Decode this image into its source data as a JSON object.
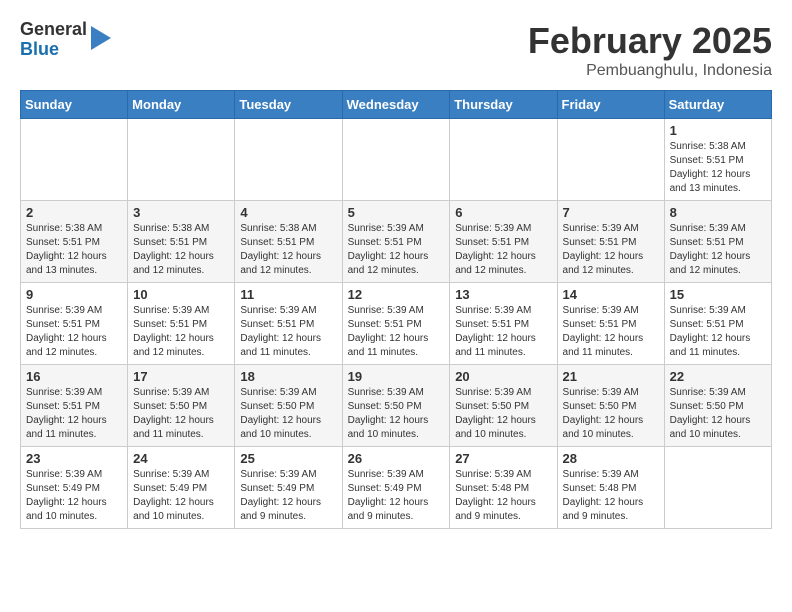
{
  "header": {
    "logo": {
      "general": "General",
      "blue": "Blue"
    },
    "title": "February 2025",
    "location": "Pembuanghulu, Indonesia"
  },
  "calendar": {
    "weekdays": [
      "Sunday",
      "Monday",
      "Tuesday",
      "Wednesday",
      "Thursday",
      "Friday",
      "Saturday"
    ],
    "weeks": [
      [
        {
          "day": "",
          "info": ""
        },
        {
          "day": "",
          "info": ""
        },
        {
          "day": "",
          "info": ""
        },
        {
          "day": "",
          "info": ""
        },
        {
          "day": "",
          "info": ""
        },
        {
          "day": "",
          "info": ""
        },
        {
          "day": "1",
          "info": "Sunrise: 5:38 AM\nSunset: 5:51 PM\nDaylight: 12 hours\nand 13 minutes."
        }
      ],
      [
        {
          "day": "2",
          "info": "Sunrise: 5:38 AM\nSunset: 5:51 PM\nDaylight: 12 hours\nand 13 minutes."
        },
        {
          "day": "3",
          "info": "Sunrise: 5:38 AM\nSunset: 5:51 PM\nDaylight: 12 hours\nand 12 minutes."
        },
        {
          "day": "4",
          "info": "Sunrise: 5:38 AM\nSunset: 5:51 PM\nDaylight: 12 hours\nand 12 minutes."
        },
        {
          "day": "5",
          "info": "Sunrise: 5:39 AM\nSunset: 5:51 PM\nDaylight: 12 hours\nand 12 minutes."
        },
        {
          "day": "6",
          "info": "Sunrise: 5:39 AM\nSunset: 5:51 PM\nDaylight: 12 hours\nand 12 minutes."
        },
        {
          "day": "7",
          "info": "Sunrise: 5:39 AM\nSunset: 5:51 PM\nDaylight: 12 hours\nand 12 minutes."
        },
        {
          "day": "8",
          "info": "Sunrise: 5:39 AM\nSunset: 5:51 PM\nDaylight: 12 hours\nand 12 minutes."
        }
      ],
      [
        {
          "day": "9",
          "info": "Sunrise: 5:39 AM\nSunset: 5:51 PM\nDaylight: 12 hours\nand 12 minutes."
        },
        {
          "day": "10",
          "info": "Sunrise: 5:39 AM\nSunset: 5:51 PM\nDaylight: 12 hours\nand 12 minutes."
        },
        {
          "day": "11",
          "info": "Sunrise: 5:39 AM\nSunset: 5:51 PM\nDaylight: 12 hours\nand 11 minutes."
        },
        {
          "day": "12",
          "info": "Sunrise: 5:39 AM\nSunset: 5:51 PM\nDaylight: 12 hours\nand 11 minutes."
        },
        {
          "day": "13",
          "info": "Sunrise: 5:39 AM\nSunset: 5:51 PM\nDaylight: 12 hours\nand 11 minutes."
        },
        {
          "day": "14",
          "info": "Sunrise: 5:39 AM\nSunset: 5:51 PM\nDaylight: 12 hours\nand 11 minutes."
        },
        {
          "day": "15",
          "info": "Sunrise: 5:39 AM\nSunset: 5:51 PM\nDaylight: 12 hours\nand 11 minutes."
        }
      ],
      [
        {
          "day": "16",
          "info": "Sunrise: 5:39 AM\nSunset: 5:51 PM\nDaylight: 12 hours\nand 11 minutes."
        },
        {
          "day": "17",
          "info": "Sunrise: 5:39 AM\nSunset: 5:50 PM\nDaylight: 12 hours\nand 11 minutes."
        },
        {
          "day": "18",
          "info": "Sunrise: 5:39 AM\nSunset: 5:50 PM\nDaylight: 12 hours\nand 10 minutes."
        },
        {
          "day": "19",
          "info": "Sunrise: 5:39 AM\nSunset: 5:50 PM\nDaylight: 12 hours\nand 10 minutes."
        },
        {
          "day": "20",
          "info": "Sunrise: 5:39 AM\nSunset: 5:50 PM\nDaylight: 12 hours\nand 10 minutes."
        },
        {
          "day": "21",
          "info": "Sunrise: 5:39 AM\nSunset: 5:50 PM\nDaylight: 12 hours\nand 10 minutes."
        },
        {
          "day": "22",
          "info": "Sunrise: 5:39 AM\nSunset: 5:50 PM\nDaylight: 12 hours\nand 10 minutes."
        }
      ],
      [
        {
          "day": "23",
          "info": "Sunrise: 5:39 AM\nSunset: 5:49 PM\nDaylight: 12 hours\nand 10 minutes."
        },
        {
          "day": "24",
          "info": "Sunrise: 5:39 AM\nSunset: 5:49 PM\nDaylight: 12 hours\nand 10 minutes."
        },
        {
          "day": "25",
          "info": "Sunrise: 5:39 AM\nSunset: 5:49 PM\nDaylight: 12 hours\nand 9 minutes."
        },
        {
          "day": "26",
          "info": "Sunrise: 5:39 AM\nSunset: 5:49 PM\nDaylight: 12 hours\nand 9 minutes."
        },
        {
          "day": "27",
          "info": "Sunrise: 5:39 AM\nSunset: 5:48 PM\nDaylight: 12 hours\nand 9 minutes."
        },
        {
          "day": "28",
          "info": "Sunrise: 5:39 AM\nSunset: 5:48 PM\nDaylight: 12 hours\nand 9 minutes."
        },
        {
          "day": "",
          "info": ""
        }
      ]
    ]
  }
}
